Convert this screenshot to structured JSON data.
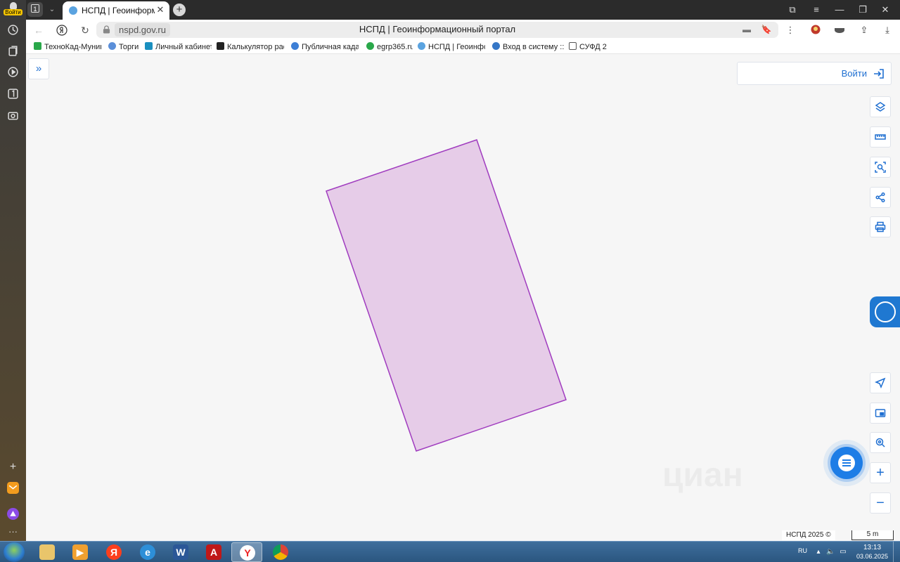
{
  "browser": {
    "side_panel": {
      "login_label": "Войти",
      "icons": [
        "history-icon",
        "collections-icon",
        "play-icon",
        "one-icon",
        "camera-icon",
        "plus-icon",
        "mail-app-icon",
        "alice-icon",
        "more-icon"
      ]
    },
    "tab_count": "1",
    "active_tab": {
      "title": "НСПД | Геоинформаци",
      "close": "✕"
    },
    "address": {
      "domain": "nspd.gov.ru",
      "page_title": "НСПД | Геоинформационный портал"
    },
    "bookmarks": [
      {
        "label": "ТехноКад-Муници",
        "color": "#2aa84a"
      },
      {
        "label": "Торги",
        "color": "#5b8fd9"
      },
      {
        "label": "Личный кабинет",
        "color": "#1a8fbf"
      },
      {
        "label": "Калькулятор расч",
        "color": "#222222"
      },
      {
        "label": "Публичная кадас",
        "color": "#3d7fd6"
      },
      {
        "label": "egrp365.ru",
        "color": "#2aa84a"
      },
      {
        "label": "НСПД | Геоинфор",
        "color": "#5aa3e0"
      },
      {
        "label": "Вход в систему :: ",
        "color": "#3577c7"
      },
      {
        "label": "СУФД 2",
        "color": "#ffffff"
      }
    ]
  },
  "map": {
    "login_label": "Войти",
    "tools_top": [
      "layers-icon",
      "ruler-icon",
      "area-select-icon",
      "share-icon",
      "print-icon"
    ],
    "tools_bottom": [
      "locate-icon",
      "minimap-icon",
      "search-location-icon",
      "zoom-in-icon",
      "zoom-out-icon"
    ],
    "watermark": "циан",
    "copyright": "НСПД 2025 ©",
    "scale_label": "5 m",
    "parcel": {
      "fill": "#e6cce8",
      "stroke": "#a03cbf"
    },
    "accent": "#1f6fd1"
  },
  "taskbar": {
    "apps": [
      "explorer",
      "media-player",
      "yandex",
      "internet-explorer",
      "word",
      "acrobat",
      "yandex-browser",
      "chrome"
    ],
    "language": "RU",
    "time": "13:13",
    "date": "03.06.2025"
  }
}
